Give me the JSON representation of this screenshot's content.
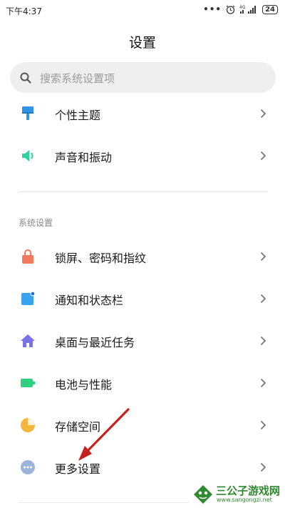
{
  "status_bar": {
    "time": "下午4:37",
    "dots": "•••",
    "battery": "24",
    "network": "4G"
  },
  "header": {
    "title": "设置"
  },
  "search": {
    "placeholder": "搜索系统设置项"
  },
  "group1": {
    "items": [
      {
        "label": "个性主题",
        "icon": "paint-brush-icon",
        "color": "#2f93e8"
      },
      {
        "label": "声音和振动",
        "icon": "speaker-icon",
        "color": "#2fd39a"
      }
    ]
  },
  "system_section": {
    "header": "系统设置",
    "items": [
      {
        "label": "锁屏、密码和指纹",
        "icon": "lock-icon",
        "color": "#f27a5e"
      },
      {
        "label": "通知和状态栏",
        "icon": "notification-icon",
        "color": "#3aa3ef"
      },
      {
        "label": "桌面与最近任务",
        "icon": "home-icon",
        "color": "#7b72e6"
      },
      {
        "label": "电池与性能",
        "icon": "battery-icon",
        "color": "#2fd17f"
      },
      {
        "label": "存储空间",
        "icon": "pie-chart-icon",
        "color": "#f5b73b"
      },
      {
        "label": "更多设置",
        "icon": "more-dots-icon",
        "color": "#9eb3d9"
      }
    ]
  },
  "annotation": {
    "arrow_color": "#c8201e"
  },
  "watermark": {
    "name": "三公子游戏网",
    "url": "www.sangongzi.net",
    "color": "#2f8a2f"
  }
}
